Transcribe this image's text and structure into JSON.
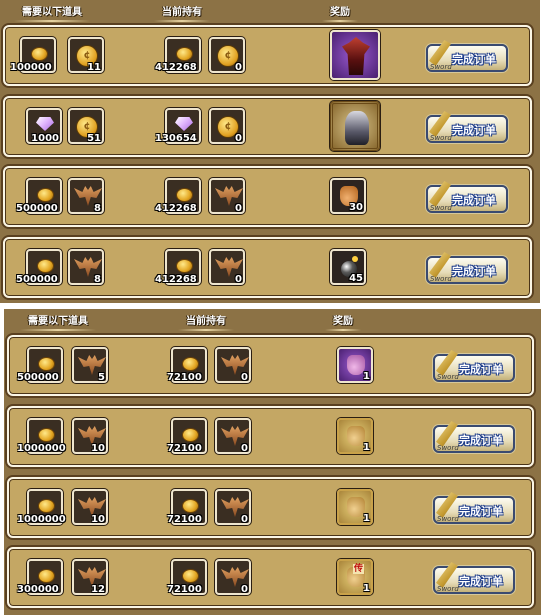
{
  "header": {
    "required_items": "需要以下道具",
    "current_holdings": "当前持有",
    "reward": "奖励"
  },
  "button": {
    "label": "完成订单",
    "caption": "Sword"
  },
  "panel_top": {
    "orders": [
      {
        "req_1": "100000",
        "req_2": "11",
        "own_1": "412268",
        "own_2": "0",
        "reward_qty": ""
      },
      {
        "req_1": "1000",
        "req_2": "51",
        "own_1": "130654",
        "own_2": "0",
        "reward_qty": ""
      },
      {
        "req_1": "500000",
        "req_2": "8",
        "own_1": "412268",
        "own_2": "0",
        "reward_qty": "30"
      },
      {
        "req_1": "500000",
        "req_2": "8",
        "own_1": "412268",
        "own_2": "0",
        "reward_qty": "45"
      }
    ]
  },
  "panel_bottom": {
    "orders": [
      {
        "req_1": "500000",
        "req_2": "5",
        "own_1": "72100",
        "own_2": "0",
        "reward_qty": "1"
      },
      {
        "req_1": "1000000",
        "req_2": "10",
        "own_1": "72100",
        "own_2": "0",
        "reward_qty": "1"
      },
      {
        "req_1": "1000000",
        "req_2": "10",
        "own_1": "72100",
        "own_2": "0",
        "reward_qty": "1"
      },
      {
        "req_1": "300000",
        "req_2": "12",
        "own_1": "72100",
        "own_2": "0",
        "reward_qty": "1",
        "reward_tag": "传"
      }
    ]
  },
  "icons": {
    "gold_coin": "gold-coin-icon",
    "big_coin": "big-coin-icon",
    "gem": "pink-gem-icon",
    "bat_wing": "bat-wing-icon",
    "demon": "demon-figure-icon",
    "knight": "armored-knight-icon",
    "sack": "loot-sack-icon",
    "bomb": "bomb-icon",
    "sword": "sword-icon"
  },
  "colors": {
    "panel": "#8c7245",
    "row": "#c4a764",
    "slot": "#3a2e22",
    "button_text_outline": "#1a3a8a"
  }
}
